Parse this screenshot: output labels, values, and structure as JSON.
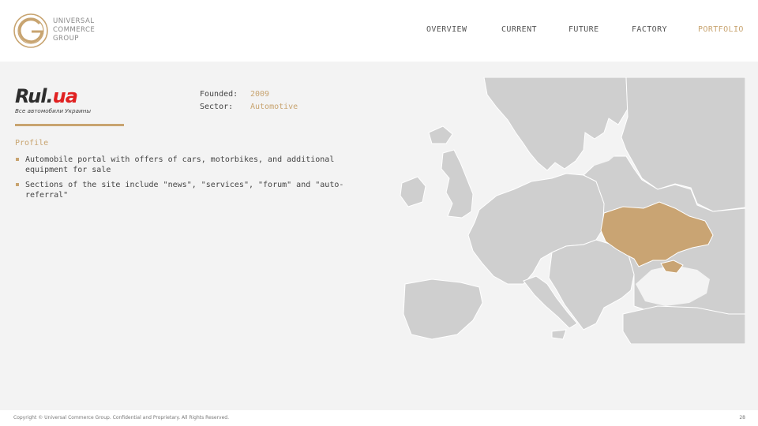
{
  "header": {
    "logo_lines": [
      "UNIVERSAL",
      "COMMERCE",
      "GROUP"
    ],
    "nav": [
      {
        "label": "OVERVIEW",
        "active": false
      },
      {
        "label": "CURRENT",
        "active": false
      },
      {
        "label": "FUTURE",
        "active": false
      },
      {
        "label": "FACTORY",
        "active": false
      },
      {
        "label": "PORTFOLIO",
        "active": true
      }
    ]
  },
  "company": {
    "logo_text_part1": "Rul.",
    "logo_text_part2": "ua",
    "logo_tagline": "Все автомобили Украины",
    "founded_label": "Founded:",
    "founded_value": "2009",
    "sector_label": "Sector:",
    "sector_value": "Automotive"
  },
  "profile": {
    "title": "Profile",
    "bullets": [
      "Automobile portal with offers of cars, motorbikes, and additional equipment for sale",
      "Sections of the site include \"news\", \"services\", \"forum\" and \"auto-referral\""
    ]
  },
  "map": {
    "highlighted_country": "Ukraine",
    "highlight_color": "#c9a473",
    "land_color": "#cfcfcf",
    "sea_color": "#f3f3f3"
  },
  "footer": {
    "copyright": "Copyright © Universal Commerce Group. Confidential and Proprietary. All Rights Reserved.",
    "page_number": "28"
  },
  "colors": {
    "accent": "#c8a470",
    "brand_red": "#e02020"
  }
}
